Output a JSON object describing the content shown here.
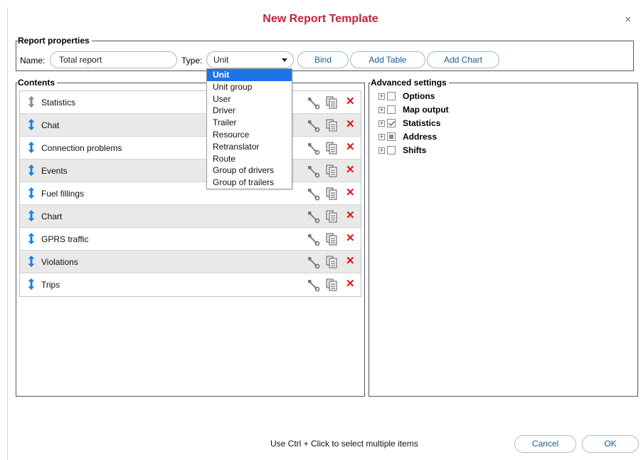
{
  "dialog": {
    "title": "New Report Template",
    "close_glyph": "×"
  },
  "report_properties": {
    "legend": "Report properties",
    "name_label": "Name:",
    "name_value": "Total report",
    "type_label": "Type:",
    "type_value": "Unit",
    "buttons": {
      "bind": "Bind",
      "add_table": "Add Table",
      "add_chart": "Add Chart"
    }
  },
  "type_dropdown": {
    "options": [
      "Unit",
      "Unit group",
      "User",
      "Driver",
      "Trailer",
      "Resource",
      "Retranslator",
      "Route",
      "Group of drivers",
      "Group of trailers"
    ],
    "selected": "Unit"
  },
  "contents": {
    "legend": "Contents",
    "rows": [
      {
        "name": "Statistics",
        "arrow_color": "#8a8a8a"
      },
      {
        "name": "Chat",
        "arrow_color": "#1e7fd8"
      },
      {
        "name": "Connection problems",
        "arrow_color": "#1e7fd8"
      },
      {
        "name": "Events",
        "arrow_color": "#1e7fd8"
      },
      {
        "name": "Fuel fillings",
        "arrow_color": "#1e7fd8"
      },
      {
        "name": "Chart",
        "arrow_color": "#1e7fd8"
      },
      {
        "name": "GPRS traffic",
        "arrow_color": "#1e7fd8"
      },
      {
        "name": "Violations",
        "arrow_color": "#1e7fd8"
      },
      {
        "name": "Trips",
        "arrow_color": "#1e7fd8"
      }
    ],
    "row_icons": [
      "wrench-icon",
      "copy-icon",
      "delete-icon"
    ]
  },
  "advanced_settings": {
    "legend": "Advanced settings",
    "items": [
      {
        "label": "Options",
        "state": "unchecked"
      },
      {
        "label": "Map output",
        "state": "unchecked"
      },
      {
        "label": "Statistics",
        "state": "checked"
      },
      {
        "label": "Address",
        "state": "partial"
      },
      {
        "label": "Shifts",
        "state": "unchecked"
      }
    ]
  },
  "footer": {
    "hint": "Use Ctrl + Click to select multiple items",
    "cancel": "Cancel",
    "ok": "OK"
  },
  "colors": {
    "title": "#c0223c",
    "accent_blue": "#1e7fd8",
    "selected_bg": "#1e73e6",
    "delete_red": "#e01010"
  }
}
